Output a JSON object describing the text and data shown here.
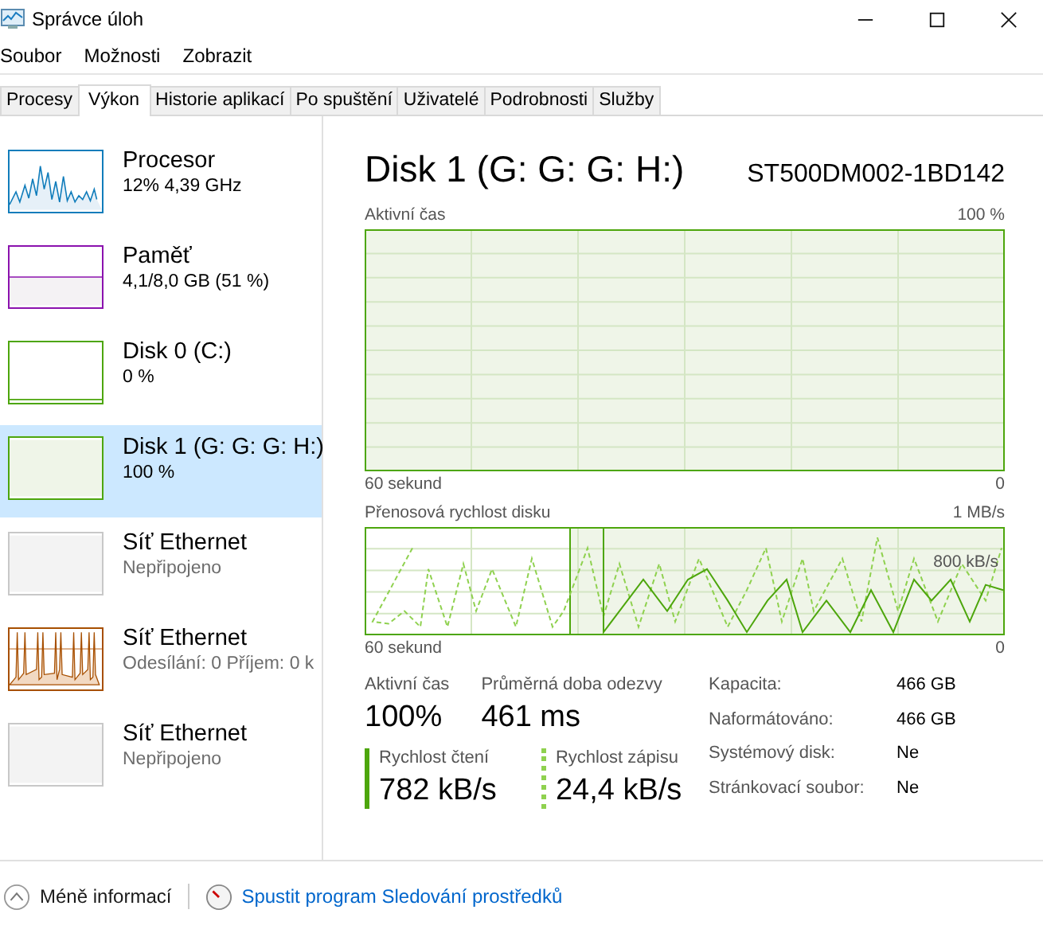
{
  "window": {
    "title": "Správce úloh"
  },
  "menu": [
    "Soubor",
    "Možnosti",
    "Zobrazit"
  ],
  "tabs": [
    {
      "label": "Procesy",
      "selected": false
    },
    {
      "label": "Výkon",
      "selected": true
    },
    {
      "label": "Historie aplikací",
      "selected": false
    },
    {
      "label": "Po spuštění",
      "selected": false
    },
    {
      "label": "Uživatelé",
      "selected": false
    },
    {
      "label": "Podrobnosti",
      "selected": false
    },
    {
      "label": "Služby",
      "selected": false
    }
  ],
  "sidebar": {
    "items": [
      {
        "kind": "cpu",
        "name": "Procesor",
        "detail": "12%  4,39 GHz",
        "color": "#117dbb",
        "selected": false
      },
      {
        "kind": "memory",
        "name": "Paměť",
        "detail": "4,1/8,0 GB (51 %)",
        "color": "#8b12ae",
        "selected": false
      },
      {
        "kind": "disk",
        "name": "Disk 0 (C:)",
        "detail": "0 %",
        "color": "#4da60c",
        "selected": false
      },
      {
        "kind": "diskbusy",
        "name": "Disk 1 (G: G: G: H:)",
        "detail": "100 %",
        "color": "#4da60c",
        "selected": true
      },
      {
        "kind": "netidle",
        "name": "Síť Ethernet",
        "detail": "Nepřipojeno",
        "color": "#c8c8c8",
        "selected": false
      },
      {
        "kind": "netbusy",
        "name": "Síť Ethernet",
        "detail": "Odesílání: 0 Příjem: 0 k",
        "color": "#a74f01",
        "selected": false
      },
      {
        "kind": "netidle",
        "name": "Síť Ethernet",
        "detail": "Nepřipojeno",
        "color": "#c8c8c8",
        "selected": false
      }
    ]
  },
  "detail": {
    "title": "Disk 1 (G: G: G: H:)",
    "model": "ST500DM002-1BD142",
    "active_chart": {
      "label": "Aktivní čas",
      "max": "100 %",
      "time": "60 sekund",
      "min": "0"
    },
    "transfer_chart": {
      "label": "Přenosová rychlost disku",
      "max": "1 MB/s",
      "mark": "800 kB/s",
      "time": "60 sekund",
      "min": "0"
    },
    "stats": [
      {
        "label": "Aktivní čas",
        "value": "100%"
      },
      {
        "label": "Průměrná doba odezvy",
        "value": "461 ms"
      }
    ],
    "rates": [
      {
        "kind": "read",
        "label": "Rychlost čtení",
        "value": "782 kB/s"
      },
      {
        "kind": "write",
        "label": "Rychlost zápisu",
        "value": "24,4 kB/s"
      }
    ],
    "properties": [
      {
        "label": "Kapacita:",
        "value": "466 GB"
      },
      {
        "label": "Naformátováno:",
        "value": "466 GB"
      },
      {
        "label": "Systémový disk:",
        "value": "Ne"
      },
      {
        "label": "Stránkovací soubor:",
        "value": "Ne"
      }
    ]
  },
  "footer": {
    "less": "Méně informací",
    "link": "Spustit program Sledování prostředků"
  }
}
